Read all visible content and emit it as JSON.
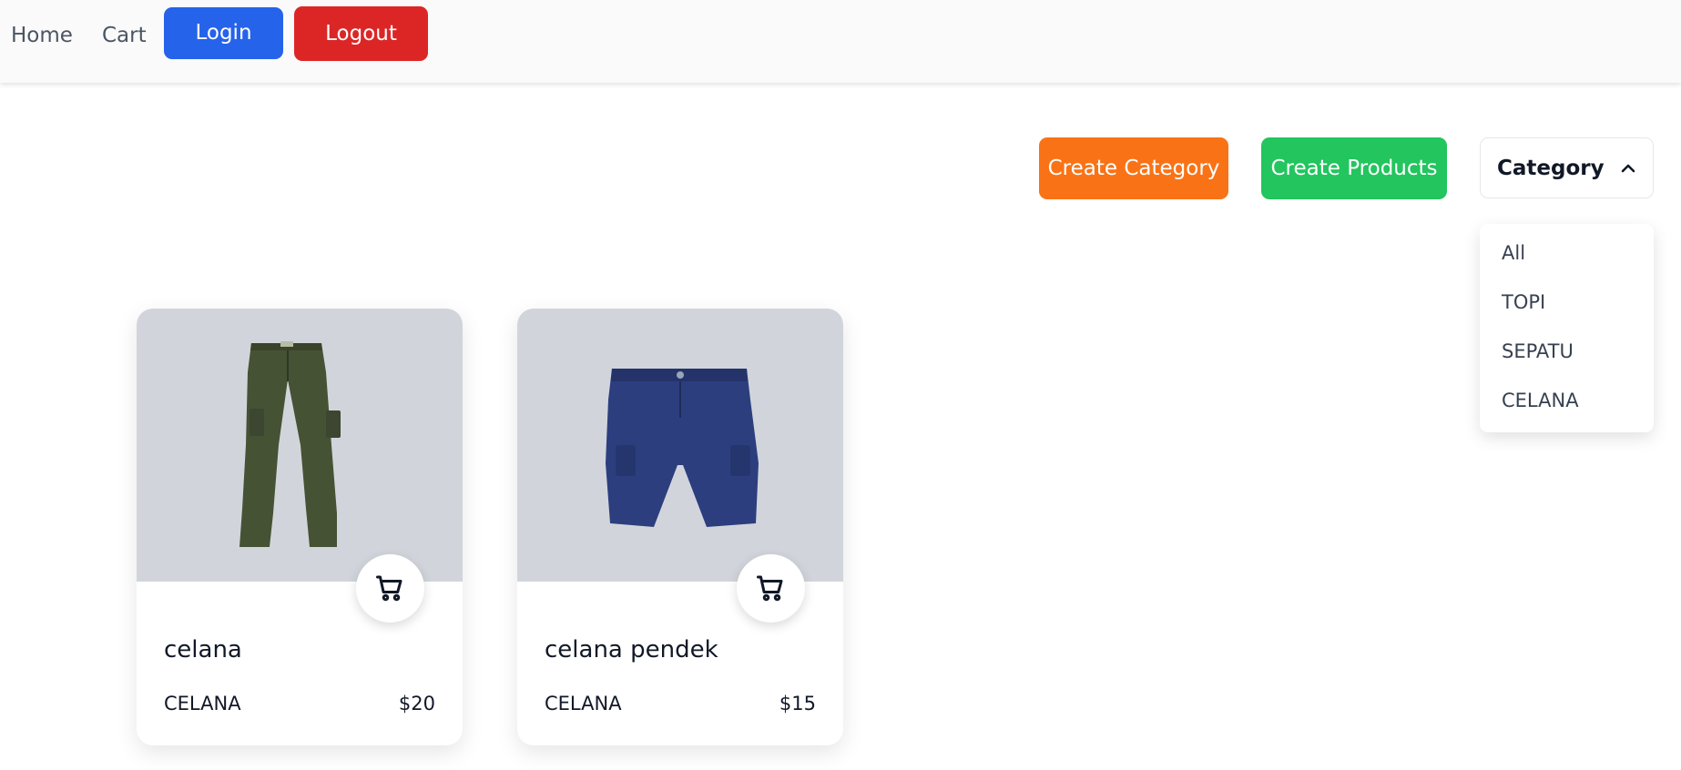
{
  "nav": {
    "home": "Home",
    "cart": "Cart",
    "login": "Login",
    "logout": "Logout"
  },
  "actions": {
    "create_category": "Create Category",
    "create_products": "Create Products"
  },
  "category_select": {
    "label": "Category",
    "options": [
      "All",
      "TOPI",
      "SEPATU",
      "CELANA"
    ]
  },
  "products": [
    {
      "title": "celana",
      "category": "CELANA",
      "price": "$20"
    },
    {
      "title": "celana pendek",
      "category": "CELANA",
      "price": "$15"
    }
  ],
  "colors": {
    "login": "#2563eb",
    "logout": "#dc2626",
    "create_category": "#f97316",
    "create_products": "#22c55e",
    "image_bg": "#d1d5db"
  },
  "icons": {
    "cart_button": "shopping-cart-icon",
    "select_toggle": "chevron-up-icon"
  }
}
